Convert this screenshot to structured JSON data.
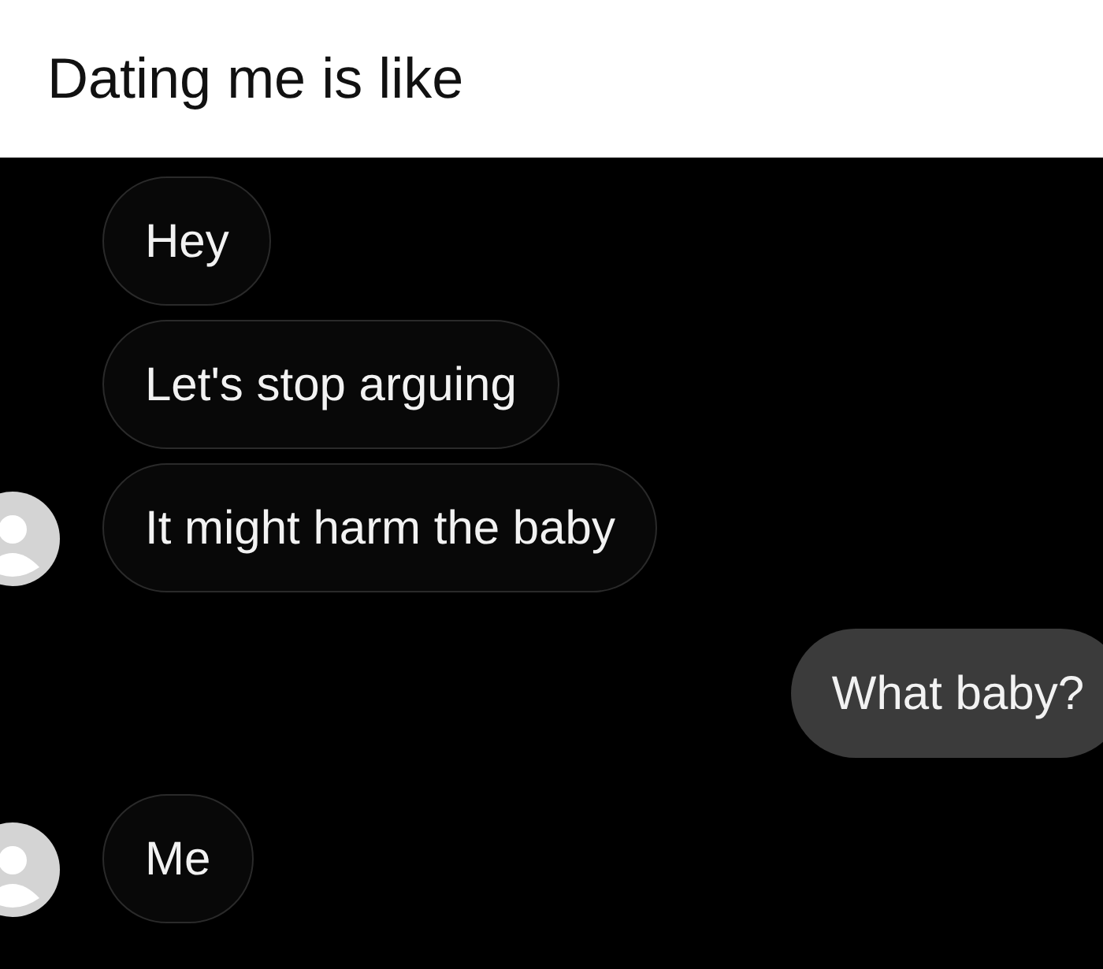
{
  "caption": "Dating me is like",
  "messages": [
    {
      "text": "Hey",
      "kind": "received",
      "avatar": false
    },
    {
      "text": "Let's stop arguing",
      "kind": "received",
      "avatar": false
    },
    {
      "text": "It might harm the baby",
      "kind": "received",
      "avatar": true
    },
    {
      "text": "What baby?",
      "kind": "sent",
      "avatar": false
    },
    {
      "text": "Me",
      "kind": "received",
      "avatar": true
    }
  ]
}
